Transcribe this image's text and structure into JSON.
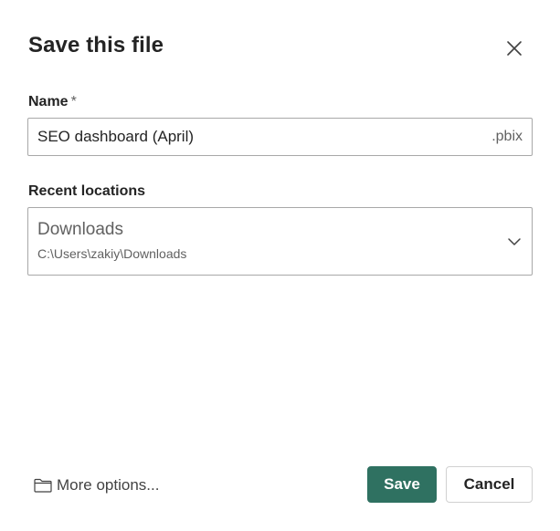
{
  "dialog": {
    "title": "Save this file",
    "close_icon": "close-icon"
  },
  "name_field": {
    "label": "Name",
    "required_marker": "*",
    "value": "SEO dashboard (April)",
    "extension": ".pbix"
  },
  "locations": {
    "label": "Recent locations",
    "selected_name": "Downloads",
    "selected_path": "C:\\Users\\zakiy\\Downloads",
    "dropdown_icon": "chevron-down-icon"
  },
  "footer": {
    "more_options_label": "More options...",
    "more_options_icon": "folder-icon",
    "save_label": "Save",
    "cancel_label": "Cancel"
  },
  "colors": {
    "primary": "#2f7161",
    "border": "#a8a8a8",
    "text": "#242424",
    "secondary_text": "#616161"
  }
}
